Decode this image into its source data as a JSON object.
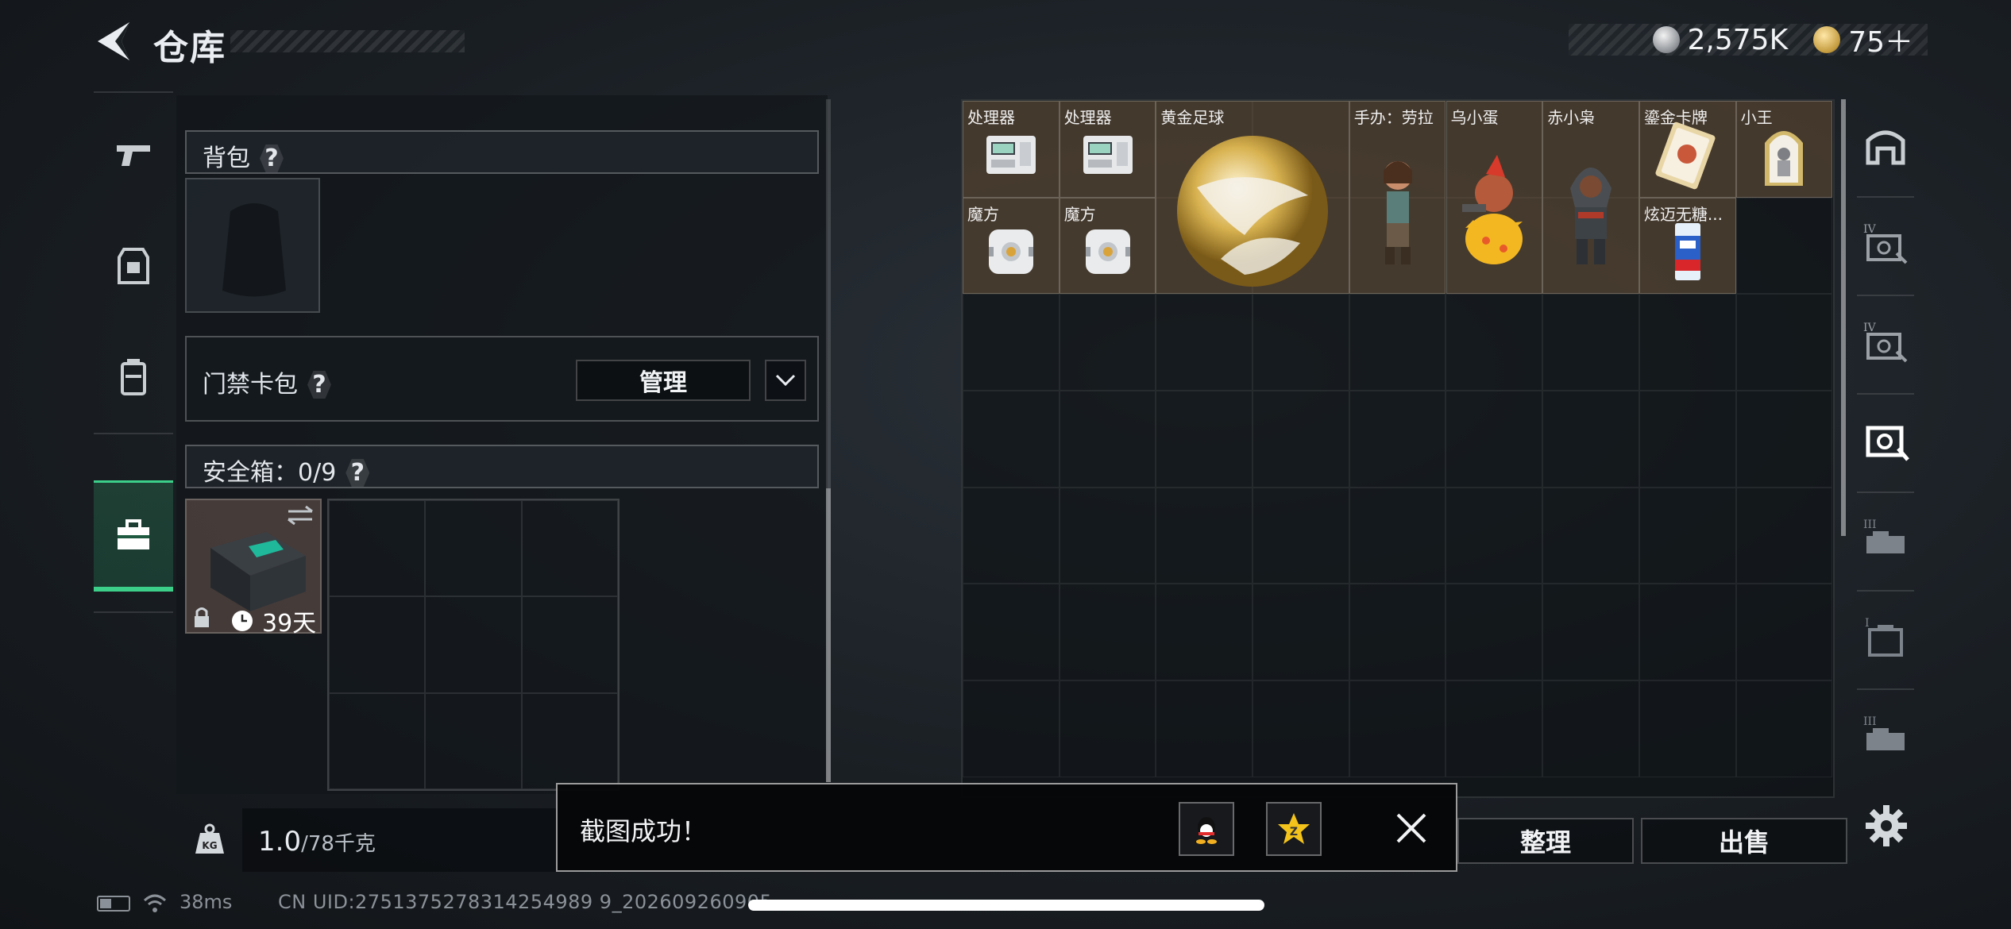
{
  "header": {
    "title": "仓库",
    "back_icon": "back-arrow-icon",
    "currencies": [
      {
        "icon": "silver-coin-icon",
        "value": "2,575K"
      },
      {
        "icon": "gold-coin-icon",
        "value": "75＋"
      }
    ]
  },
  "left_nav": {
    "items": [
      {
        "icon": "pistol-icon",
        "active": false
      },
      {
        "icon": "vest-icon",
        "active": false
      },
      {
        "icon": "backpack-icon",
        "active": false
      },
      {
        "icon": "toolbox-icon",
        "active": true
      }
    ]
  },
  "backpack": {
    "label": "背包",
    "help": "?"
  },
  "keycard": {
    "label": "门禁卡包",
    "help": "?",
    "manage_label": "管理"
  },
  "safebox": {
    "label": "安全箱：0/9",
    "help": "?",
    "duration": "39天"
  },
  "weight": {
    "current": "1.0",
    "max": "/78千克"
  },
  "storage": {
    "items": [
      {
        "name": "处理器",
        "art": "processor"
      },
      {
        "name": "处理器",
        "art": "processor"
      },
      {
        "name": "黄金足球",
        "art": "golden-ball"
      },
      {
        "name": "手办：劳拉",
        "art": "figure-lara"
      },
      {
        "name": "乌小蛋",
        "art": "egg-figure"
      },
      {
        "name": "赤小枭",
        "art": "hooded-figure"
      },
      {
        "name": "鎏金卡牌",
        "art": "gold-card"
      },
      {
        "name": "小王",
        "art": "joker-card"
      },
      {
        "name": "魔方",
        "art": "cube"
      },
      {
        "name": "魔方",
        "art": "cube"
      },
      {
        "name": "炫迈无糖...",
        "art": "gum"
      }
    ]
  },
  "right_tabs": [
    {
      "icon": "shelter-icon"
    },
    {
      "icon": "storage-tier-iv-icon"
    },
    {
      "icon": "storage-tier-iv-icon"
    },
    {
      "icon": "storage-active-icon"
    },
    {
      "icon": "storage-tier-iii-icon"
    },
    {
      "icon": "storage-tier-i-icon"
    },
    {
      "icon": "storage-tier-iii-icon"
    }
  ],
  "actions": {
    "sort_label": "整理",
    "sell_label": "出售"
  },
  "toast": {
    "message": "截图成功！",
    "share_qq_icon": "qq-icon",
    "share_qzone_icon": "qzone-icon"
  },
  "status": {
    "ping": "38ms",
    "uid": "CN UID:2751375278314254989 9_202609260905",
    "battery_level": 0.4
  },
  "colors": {
    "accent": "#3ccf8a",
    "item_bg": "#6e553c"
  }
}
